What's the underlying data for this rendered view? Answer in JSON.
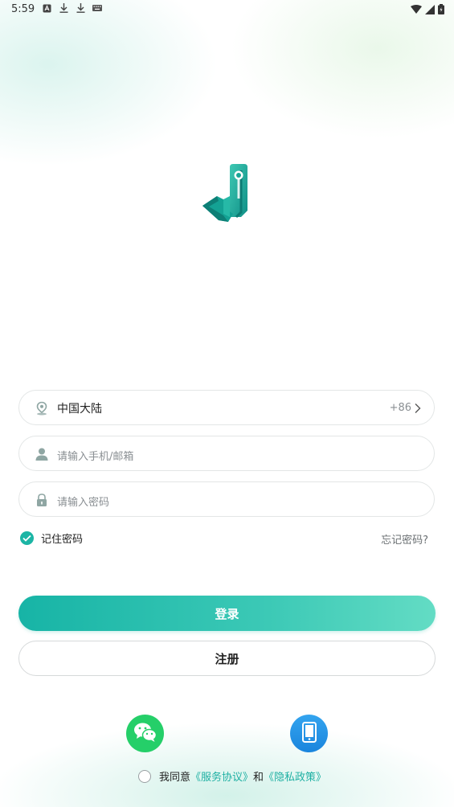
{
  "status_bar": {
    "time": "5:59"
  },
  "region": {
    "label": "中国大陆",
    "code": "+86"
  },
  "phone_field": {
    "placeholder": "请输入手机/邮箱"
  },
  "password_field": {
    "placeholder": "请输入密码"
  },
  "remember": {
    "label": "记住密码",
    "checked": true
  },
  "forgot_label": "忘记密码?",
  "login_label": "登录",
  "register_label": "注册",
  "social": [
    {
      "name": "wechat-icon",
      "color": "#25cf69"
    },
    {
      "name": "phone-icon",
      "color": "#1a85dd"
    }
  ],
  "agreement": {
    "prefix": "我同意",
    "terms": "《服务协议》",
    "and": "和",
    "privacy": "《隐私政策》"
  },
  "colors": {
    "accent": "#1cb5a5",
    "link": "#1fb0a3"
  }
}
